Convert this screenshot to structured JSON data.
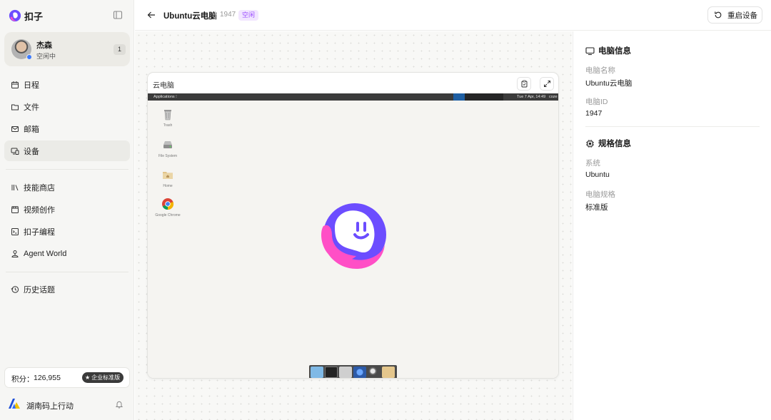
{
  "app": {
    "name": "扣子"
  },
  "user": {
    "name": "杰森",
    "status": "空闲中",
    "badge": "1"
  },
  "sidebar": {
    "group1": [
      {
        "label": "日程",
        "icon": "calendar-icon"
      },
      {
        "label": "文件",
        "icon": "folder-icon"
      },
      {
        "label": "邮箱",
        "icon": "mail-icon"
      },
      {
        "label": "设备",
        "icon": "device-icon",
        "active": true
      }
    ],
    "group2": [
      {
        "label": "技能商店",
        "icon": "library-icon"
      },
      {
        "label": "视频创作",
        "icon": "clapperboard-icon"
      },
      {
        "label": "扣子编程",
        "icon": "terminal-icon"
      },
      {
        "label": "Agent World",
        "icon": "agent-icon"
      }
    ],
    "group3": [
      {
        "label": "历史话题",
        "icon": "history-icon"
      }
    ],
    "points": {
      "label": "积分：",
      "value": "126,955",
      "plan": "企业标准版"
    },
    "org": {
      "name": "湖南码上行动"
    }
  },
  "header": {
    "title": "Ubuntu云电脑",
    "id": "1947",
    "status": "空闲",
    "restart_label": "重启设备"
  },
  "vm": {
    "title": "云电脑",
    "desktop": {
      "topbar_apps": "Applications ⁝",
      "clock": "Tue  7 Apr, 14:49",
      "user": "coze",
      "icons": [
        {
          "label": "Trash",
          "icon": "trash-icon"
        },
        {
          "label": "File System",
          "icon": "drive-icon"
        },
        {
          "label": "Home",
          "icon": "home-folder-icon"
        },
        {
          "label": "Google Chrome",
          "icon": "chrome-icon"
        }
      ]
    }
  },
  "info": {
    "computer": {
      "heading": "电脑信息",
      "name_label": "电脑名称",
      "name_value": "Ubuntu云电脑",
      "id_label": "电脑ID",
      "id_value": "1947"
    },
    "spec": {
      "heading": "规格信息",
      "os_label": "系统",
      "os_value": "Ubuntu",
      "plan_label": "电脑规格",
      "plan_value": "标准版"
    }
  },
  "colors": {
    "accent_purple": "#6c4dff",
    "accent_pink": "#ff4fc6",
    "status_bg": "#f2e6ff",
    "status_text": "#9b4dff"
  }
}
